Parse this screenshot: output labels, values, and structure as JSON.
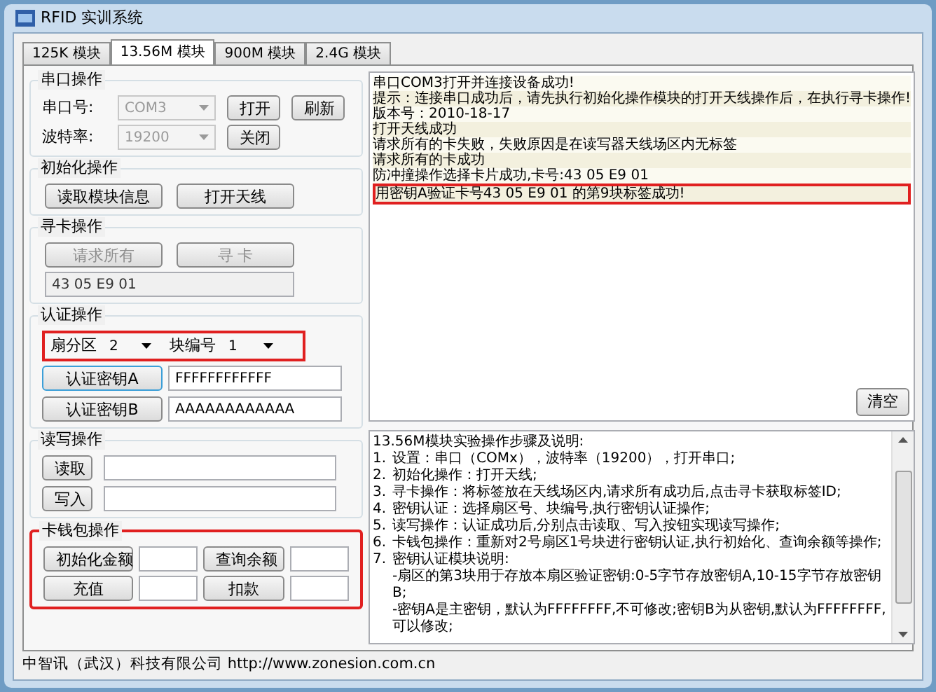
{
  "window": {
    "title": "RFID 实训系统"
  },
  "tabs": [
    {
      "label": "125K 模块",
      "selected": false
    },
    {
      "label": "13.56M 模块",
      "selected": true
    },
    {
      "label": "900M 模块",
      "selected": false
    },
    {
      "label": "2.4G 模块",
      "selected": false
    }
  ],
  "serial": {
    "title": "串口操作",
    "port_label": "串口号:",
    "port_value": "COM3",
    "baud_label": "波特率:",
    "baud_value": "19200",
    "disabled": true,
    "open_button": "打开",
    "refresh_button": "刷新",
    "close_button": "关闭"
  },
  "init": {
    "title": "初始化操作",
    "buttons": [
      "读取模块信息",
      "打开天线"
    ]
  },
  "find": {
    "title": "寻卡操作",
    "buttons": [
      {
        "label": "请求所有",
        "disabled": true
      },
      {
        "label": "寻 卡",
        "disabled": true
      }
    ],
    "card_id": "43 05 E9 01"
  },
  "auth": {
    "title": "认证操作",
    "highlighted": true,
    "sector_label": "扇分区",
    "sector_value": "2",
    "block_label": "块编号",
    "block_value": "1",
    "keys": [
      {
        "button": "认证密钥A",
        "focused": true,
        "value": "FFFFFFFFFFFF"
      },
      {
        "button": "认证密钥B",
        "focused": false,
        "value": "AAAAAAAAAAAA"
      }
    ]
  },
  "rw": {
    "title": "读写操作",
    "buttons": [
      "读取",
      "写入"
    ]
  },
  "wallet": {
    "title": "卡钱包操作",
    "highlighted": true,
    "buttons": [
      "初始化金额",
      "查询余额",
      "充值",
      "扣款"
    ]
  },
  "log": {
    "lines": [
      {
        "text": "串口COM3打开并连接设备成功!",
        "highlighted": false
      },
      {
        "text": "提示：连接串口成功后，请先执行初始化操作模块的打开天线操作后，在执行寻卡操作!",
        "highlighted": false
      },
      {
        "text": "版本号：2010-18-17",
        "highlighted": false
      },
      {
        "text": "打开天线成功",
        "highlighted": false
      },
      {
        "text": "请求所有的卡失败，失败原因是在读写器天线场区内无标签",
        "highlighted": false
      },
      {
        "text": "请求所有的卡成功",
        "highlighted": false
      },
      {
        "text": "防冲撞操作选择卡片成功,卡号:43  05 E9 01",
        "highlighted": false
      },
      {
        "text": "用密钥A验证卡号43  05  E9  01 的第9块标签成功!",
        "highlighted": true
      }
    ],
    "clear_button": "清空"
  },
  "instructions": [
    {
      "kind": "head",
      "text": "13.56M模块实验操作步骤及说明:"
    },
    {
      "kind": "step",
      "number": "1.",
      "text": "设置：串口（COMx），波特率（19200），打开串口;"
    },
    {
      "kind": "step",
      "number": "2.",
      "text": "初始化操作：打开天线;"
    },
    {
      "kind": "step",
      "number": "3.",
      "text": "寻卡操作：将标签放在天线场区内,请求所有成功后,点击寻卡获取标签ID;"
    },
    {
      "kind": "step",
      "number": "4.",
      "text": "密钥认证：选择扇区号、块编号,执行密钥认证操作;"
    },
    {
      "kind": "step",
      "number": "5.",
      "text": "读写操作：认证成功后,分别点击读取、写入按钮实现读写操作;"
    },
    {
      "kind": "step",
      "number": "6.",
      "text": "卡钱包操作：重新对2号扇区1号块进行密钥认证,执行初始化、查询余额等操作;"
    },
    {
      "kind": "step",
      "number": "7.",
      "text": "密钥认证模块说明:"
    },
    {
      "kind": "note",
      "text": "-扇区的第3块用于存放本扇区验证密钥:0-5字节存放密钥A,10-15字节存放密钥B;"
    },
    {
      "kind": "note",
      "text": "-密钥A是主密钥，默认为FFFFFFFF,不可修改;密钥B为从密钥,默认为FFFFFFFF,可以修改;"
    }
  ],
  "status_bar": "中智讯（武汉）科技有限公司 http://www.zonesion.com.cn"
}
